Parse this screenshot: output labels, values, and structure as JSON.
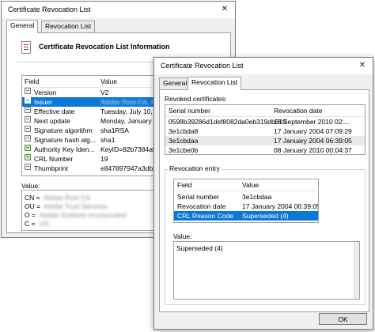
{
  "main_window": {
    "title": "Certificate Revocation List",
    "tabs": [
      "General",
      "Revocation List"
    ],
    "header_title": "Certificate Revocation List Information",
    "columns": [
      "Field",
      "Value"
    ],
    "fields": [
      {
        "field": "Version",
        "value": "V2"
      },
      {
        "field": "Issuer",
        "value": "Adobe Root CA, Adob"
      },
      {
        "field": "Effective date",
        "value": "Tuesday, July 10, 2"
      },
      {
        "field": "Next update",
        "value": "Monday, January 9,"
      },
      {
        "field": "Signature algorithm",
        "value": "sha1RSA"
      },
      {
        "field": "Signature hash alg...",
        "value": "sha1"
      },
      {
        "field": "Authority Key Iden...",
        "value": "KeyID=82b7384a93"
      },
      {
        "field": "CRL Number",
        "value": "19"
      },
      {
        "field": "Thumbprint",
        "value": "e847897947a3db26"
      }
    ],
    "value_label": "Value:",
    "value_lines": [
      {
        "key": "CN =",
        "val": "Adobe Root CA"
      },
      {
        "key": "OU =",
        "val": "Adobe Trust Services"
      },
      {
        "key": "O =",
        "val": "Adobe Systems Incorporated"
      },
      {
        "key": "C =",
        "val": "US"
      }
    ]
  },
  "revocation_window": {
    "title": "Certificate Revocation List",
    "tabs": [
      "General",
      "Revocation List"
    ],
    "revoked_label": "Revoked certificates:",
    "columns": [
      "Serial number",
      "Revocation date"
    ],
    "certs": [
      {
        "serial": "0598b39286d1def8082da0eb319db610",
        "date": "18 September 2010 02:..."
      },
      {
        "serial": "3e1cbda8",
        "date": "17 January 2004 07:09:29"
      },
      {
        "serial": "3e1cbdaa",
        "date": "17 January 2004 06:39:05"
      },
      {
        "serial": "3e1cbe0b",
        "date": "08 January 2010 00:04:37"
      }
    ],
    "entry_label": "Revocation entry",
    "entry_columns": [
      "Field",
      "Value"
    ],
    "entries": [
      {
        "field": "Serial number",
        "value": "3e1cbdaa"
      },
      {
        "field": "Revocation date",
        "value": "17 January 2004 06:39:05"
      },
      {
        "field": "CRL Reason Code",
        "value": "Superseded (4)"
      }
    ],
    "value_label": "Value:",
    "value_text": "Superseded (4)",
    "ok_label": "OK"
  }
}
